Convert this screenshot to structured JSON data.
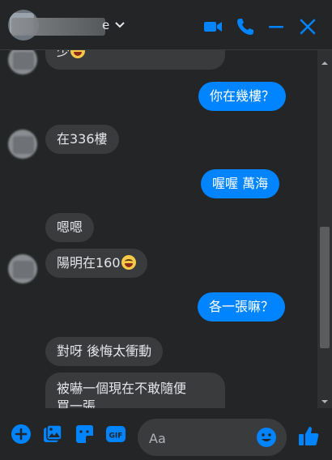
{
  "header": {
    "name_visible": "e",
    "accent": "#0084ff",
    "icons": [
      "video-icon",
      "phone-icon",
      "minimize-icon",
      "close-icon"
    ]
  },
  "messages": [
    {
      "side": "in",
      "text": "少"
    },
    {
      "side": "out",
      "text": "你在幾樓？"
    },
    {
      "side": "in",
      "text": "在336樓"
    },
    {
      "side": "out",
      "text": "喔喔  萬海"
    },
    {
      "side": "in",
      "text": "嗯嗯"
    },
    {
      "side": "in",
      "text": "陽明在160"
    },
    {
      "side": "out",
      "text": "各一張嘛？"
    },
    {
      "side": "in",
      "text": "對呀 後悔太衝動"
    },
    {
      "side": "in",
      "text": "被嚇一個現在不敢隨便"
    },
    {
      "side": "in",
      "text": "買一張"
    }
  ],
  "composer": {
    "placeholder": "Aa",
    "icons": [
      "add-icon",
      "image-icon",
      "sticker-icon",
      "gif-icon",
      "emoji-icon",
      "like-icon"
    ],
    "gif_label": "GIF"
  },
  "colors": {
    "background": "#242526",
    "incoming_bubble": "#3a3b3c",
    "outgoing_bubble": "#0084ff"
  }
}
